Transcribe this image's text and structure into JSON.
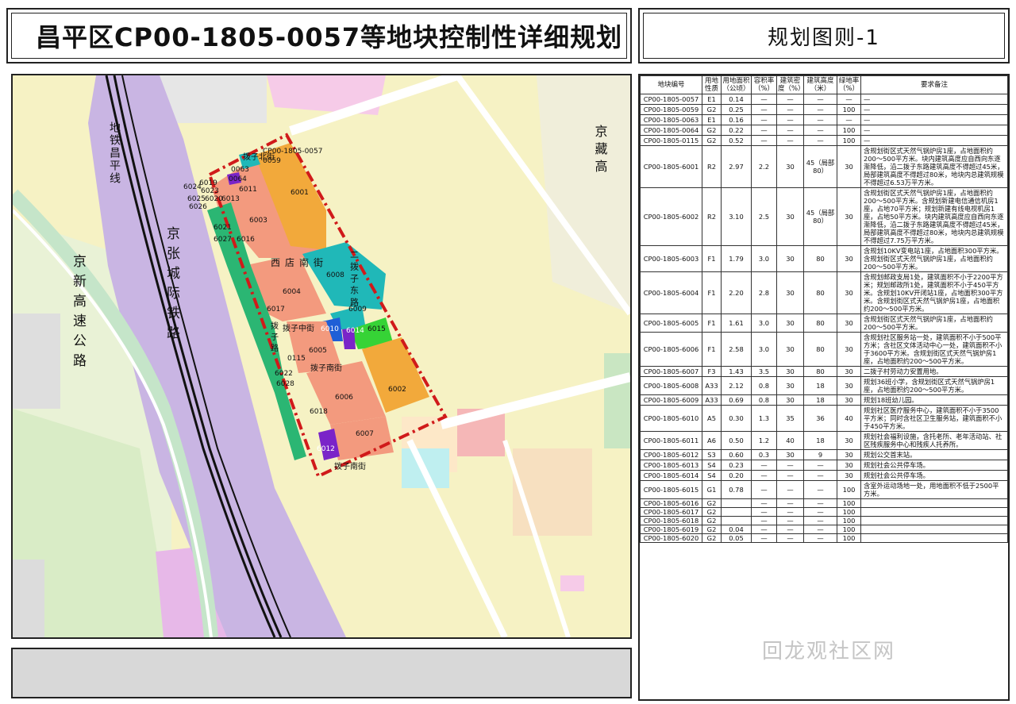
{
  "header": {
    "title": "昌平区CP00-1805-0057等地块控制性详细规划",
    "rule_title": "规划图则-1"
  },
  "map": {
    "parcels": {
      "p0057": "CP00-1805-0057",
      "p0059": "0059",
      "p0063": "0063",
      "p0064": "0064",
      "p6001": "6001",
      "p6002": "6002",
      "p6003": "6003",
      "p6004": "6004",
      "p6005": "6005",
      "p6006": "6006",
      "p6007": "6007",
      "p6008": "6008",
      "p6009": "6009",
      "p6010": "6010",
      "p6011": "6011",
      "p6012": "6012",
      "p6013": "6013",
      "p6014": "6014",
      "p6015": "6015",
      "p6016": "6016",
      "p6017": "6017",
      "p6018": "6018",
      "p6019": "6019",
      "p6020": "6020",
      "p6021": "6021",
      "p6022": "6022",
      "p6023": "6023",
      "p6024": "6024",
      "p6025": "6025",
      "p6026": "6026",
      "p6027": "6027",
      "p6028": "6028",
      "p0115": "0115"
    },
    "roads": {
      "subway": "地铁昌平线",
      "jingzhang": "京张城际铁路",
      "jingxin": "京新高速公路",
      "jingzang": "京藏高",
      "xidiannan": "西店南街",
      "erbozi": "二拨子东路",
      "bozi_north": "拨子北街",
      "bozi_mid": "拨子中街",
      "bozi_south": "拨子南街",
      "bozi_road": "拨子路",
      "bozi_south2": "拨子南街"
    }
  },
  "table": {
    "headers": [
      "地块编号",
      "用地性质",
      "用地面积（公顷）",
      "容积率（%）",
      "建筑密度（%）",
      "建筑高度（米）",
      "绿地率（%）",
      "要求备注"
    ],
    "rows": [
      [
        "CP00-1805-0057",
        "E1",
        "0.14",
        "—",
        "—",
        "—",
        "—",
        "—"
      ],
      [
        "CP00-1805-0059",
        "G2",
        "0.25",
        "—",
        "—",
        "—",
        "100",
        "—"
      ],
      [
        "CP00-1805-0063",
        "E1",
        "0.16",
        "—",
        "—",
        "—",
        "—",
        "—"
      ],
      [
        "CP00-1805-0064",
        "G2",
        "0.22",
        "—",
        "—",
        "—",
        "100",
        "—"
      ],
      [
        "CP00-1805-0115",
        "G2",
        "0.52",
        "—",
        "—",
        "—",
        "100",
        "—"
      ],
      [
        "CP00-1805-6001",
        "R2",
        "2.97",
        "2.2",
        "30",
        "45（局部80）",
        "30",
        "含规划街区式天然气锅炉房1座，占地面积约200～500平方米。块内建筑高度应自西向东逐渐降低，沿二拨子东路建筑高度不得超过45米，局部建筑高度不得超过80米，地块内总建筑规模不得超过6.53万平方米。"
      ],
      [
        "CP00-1805-6002",
        "R2",
        "3.10",
        "2.5",
        "30",
        "45（局部80）",
        "30",
        "含规划街区式天然气锅炉房1座，占地面积约200～500平方米。含规划新建电信通信机房1座，占地70平方米；规划新建有线电视机房1座，占地50平方米。块内建筑高度应自西向东逐渐降低，沿二拨子东路建筑高度不得超过45米，局部建筑高度不得超过80米，地块内总建筑规模不得超过7.75万平方米。"
      ],
      [
        "CP00-1805-6003",
        "F1",
        "1.79",
        "3.0",
        "30",
        "80",
        "30",
        "含规划10KV变电站1座，占地面积300平方米。含规划街区式天然气锅炉房1座，占地面积约200～500平方米。"
      ],
      [
        "CP00-1805-6004",
        "F1",
        "2.20",
        "2.8",
        "30",
        "80",
        "30",
        "含规划邮政支局1处，建筑面积不小于2200平方米；规划邮政所1处，建筑面积不小于450平方米。含规划10KV开闭站1座，占地面积300平方米。含规划街区式天然气锅炉房1座，占地面积约200～500平方米。"
      ],
      [
        "CP00-1805-6005",
        "F1",
        "1.61",
        "3.0",
        "30",
        "80",
        "30",
        "含规划街区式天然气锅炉房1座，占地面积约200～500平方米。"
      ],
      [
        "CP00-1805-6006",
        "F1",
        "2.58",
        "3.0",
        "30",
        "80",
        "30",
        "含规划社区服务站一处，建筑面积不小于500平方米；含社区文体活动中心一处，建筑面积不小于3600平方米。含规划街区式天然气锅炉房1座，占地面积约200～500平方米。"
      ],
      [
        "CP00-1805-6007",
        "F3",
        "1.43",
        "3.5",
        "30",
        "80",
        "30",
        "二拨子村劳动力安置用地。"
      ],
      [
        "CP00-1805-6008",
        "A33",
        "2.12",
        "0.8",
        "30",
        "18",
        "30",
        "规划36班小学，含规划街区式天然气锅炉房1座，占地面积约200～500平方米。"
      ],
      [
        "CP00-1805-6009",
        "A33",
        "0.69",
        "0.8",
        "30",
        "18",
        "30",
        "规划18班幼儿园。"
      ],
      [
        "CP00-1805-6010",
        "A5",
        "0.30",
        "1.3",
        "35",
        "36",
        "40",
        "规划社区医疗服务中心，建筑面积不小于3500平方米；同时含社区卫生服务站，建筑面积不小于450平方米。"
      ],
      [
        "CP00-1805-6011",
        "A6",
        "0.50",
        "1.2",
        "40",
        "18",
        "30",
        "规划社会福利设施，含托老所、老年活动站、社区残疾服务中心和残疾人托养所。"
      ],
      [
        "CP00-1805-6012",
        "S3",
        "0.60",
        "0.3",
        "30",
        "9",
        "30",
        "规划公交首末站。"
      ],
      [
        "CP00-1805-6013",
        "S4",
        "0.23",
        "—",
        "—",
        "—",
        "30",
        "规划社会公共停车场。"
      ],
      [
        "CP00-1805-6014",
        "S4",
        "0.20",
        "—",
        "—",
        "—",
        "30",
        "规划社会公共停车场。"
      ],
      [
        "CP00-1805-6015",
        "G1",
        "0.78",
        "—",
        "—",
        "—",
        "100",
        "含室外运动场地一处，用地面积不低于2500平方米。"
      ],
      [
        "CP00-1805-6016",
        "G2",
        "",
        "—",
        "—",
        "—",
        "100",
        ""
      ],
      [
        "CP00-1805-6017",
        "G2",
        "",
        "—",
        "—",
        "—",
        "100",
        ""
      ],
      [
        "CP00-1805-6018",
        "G2",
        "",
        "—",
        "—",
        "—",
        "100",
        ""
      ],
      [
        "CP00-1805-6019",
        "G2",
        "0.04",
        "—",
        "—",
        "—",
        "100",
        ""
      ],
      [
        "CP00-1805-6020",
        "G2",
        "0.05",
        "—",
        "—",
        "—",
        "100",
        ""
      ]
    ]
  },
  "watermark": "回龙观社区网",
  "colors": {
    "residential": "#f2a93b",
    "commercial": "#f39a7e",
    "school": "#20b8b8",
    "green": "#2bb673",
    "sports": "#36d336",
    "purple": "#7a24c8",
    "blue": "#1f5fd6",
    "rail": "#c9b5e3",
    "boundary": "#d01a1a",
    "background": "#f4f0b8"
  }
}
